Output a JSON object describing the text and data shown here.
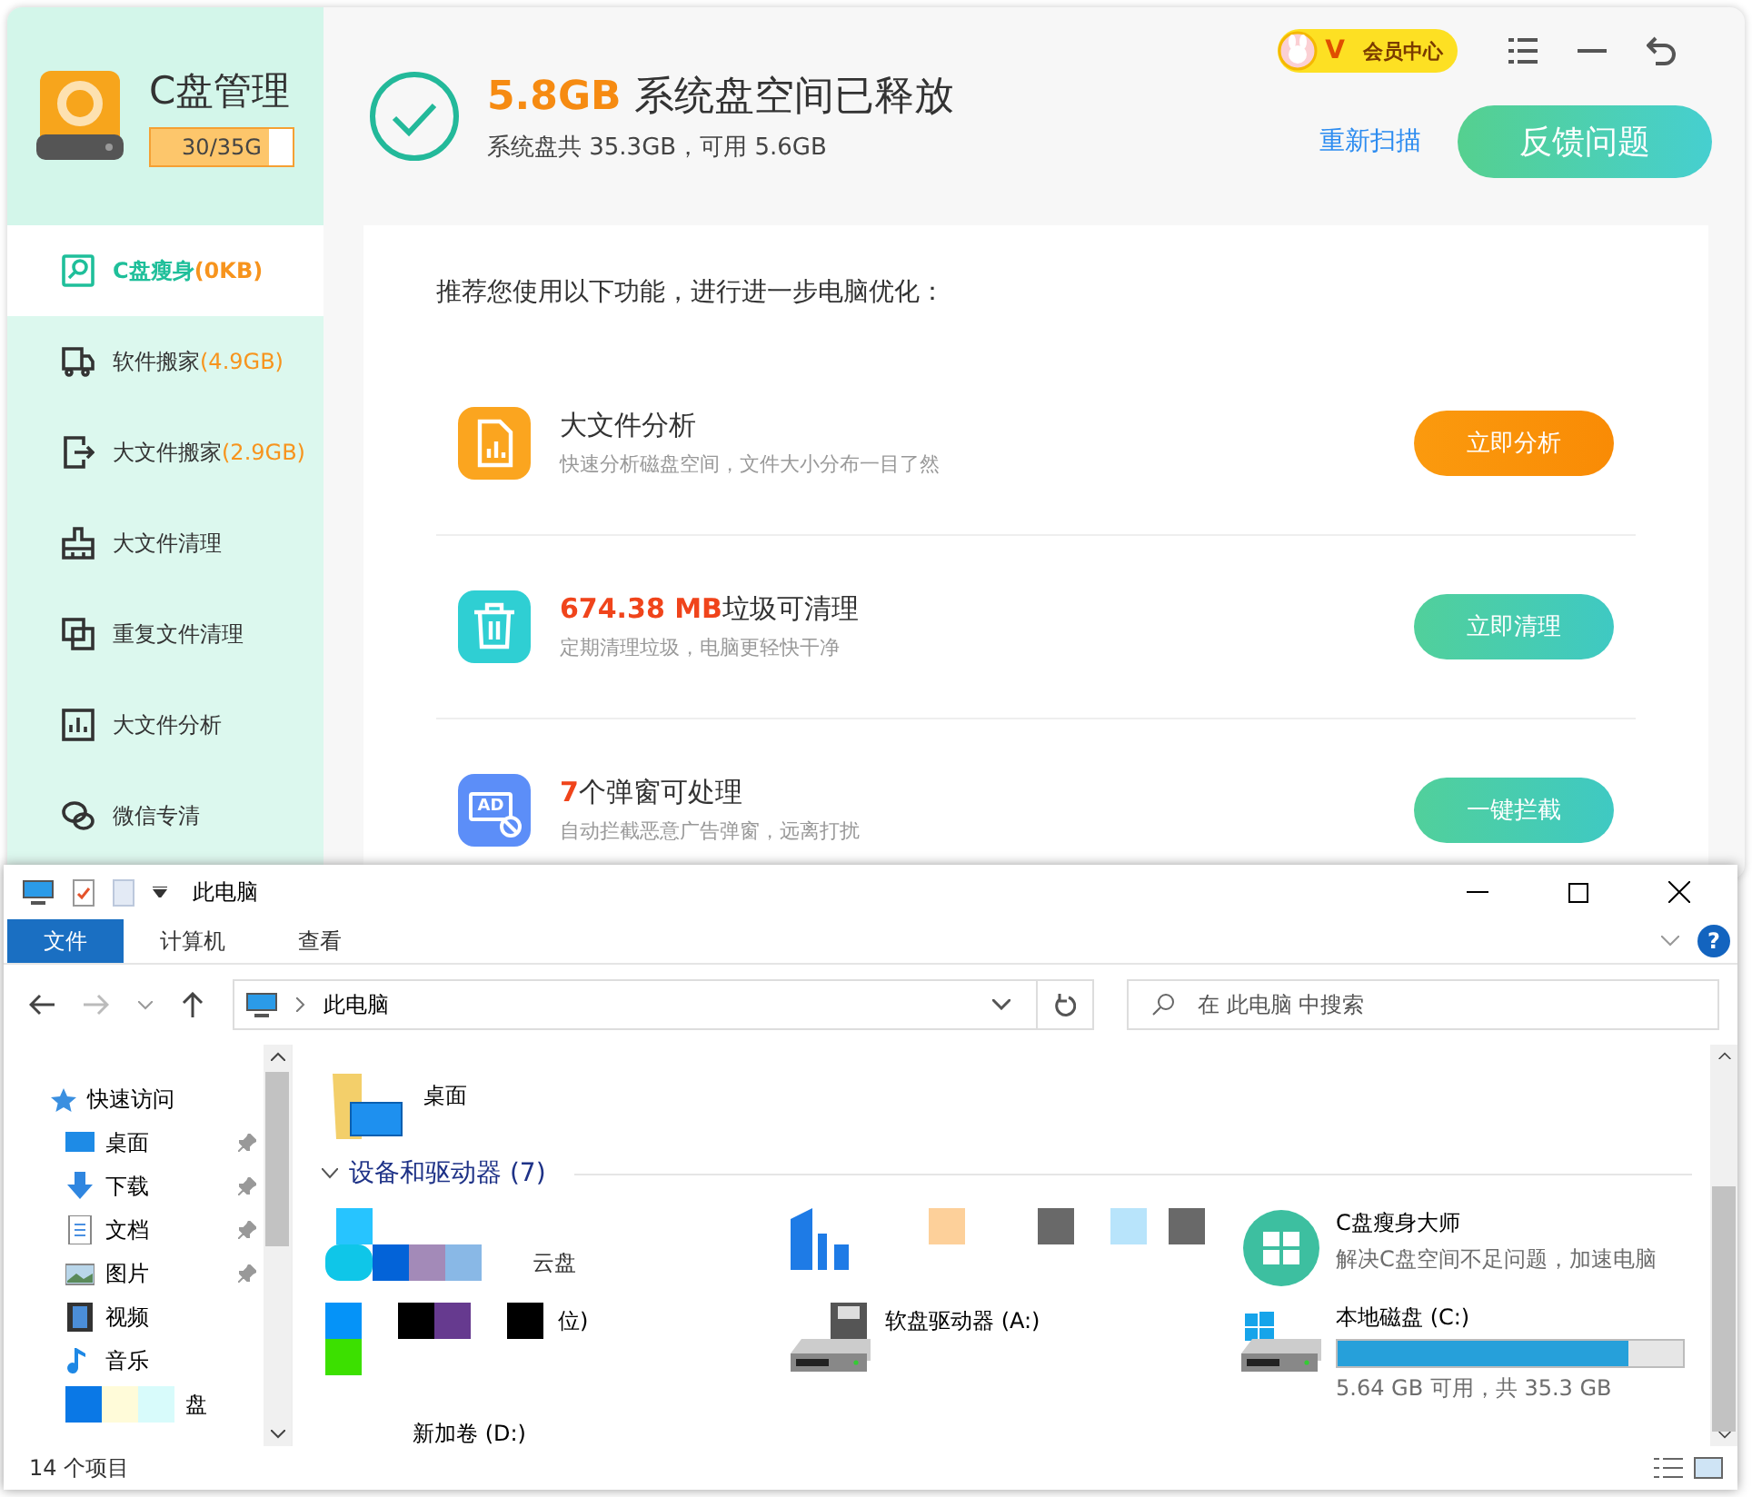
{
  "app": {
    "title": "C盘管理",
    "capacity": {
      "text": "30/35G",
      "level": 0.83
    },
    "vip": {
      "badge": "V",
      "label": "会员中心"
    },
    "header": {
      "highlight": "5.8GB",
      "title": "系统盘空间已释放",
      "subtitle": "系统盘共 35.3GB，可用 5.6GB",
      "rescan": "重新扫描",
      "feedback": "反馈问题"
    },
    "sidebar": [
      {
        "kind": "slim",
        "label": "C盘瘦身",
        "extra": "(0KB)",
        "selected": true
      },
      {
        "kind": "truck",
        "label": "软件搬家",
        "extra": "(4.9GB)",
        "selected": false
      },
      {
        "kind": "move",
        "label": "大文件搬家",
        "extra": "(2.9GB)",
        "selected": false
      },
      {
        "kind": "broom",
        "label": "大文件清理",
        "selected": false
      },
      {
        "kind": "copy",
        "label": "重复文件清理",
        "selected": false
      },
      {
        "kind": "chart",
        "label": "大文件分析",
        "selected": false
      },
      {
        "kind": "wechat",
        "label": "微信专清",
        "selected": false
      }
    ],
    "intro": "推荐您使用以下功能，进行进一步电脑优化：",
    "cards": [
      {
        "kind": "file",
        "title": "大文件分析",
        "desc": "快速分析磁盘空间，文件大小分布一目了然",
        "button": "立即分析"
      },
      {
        "kind": "trash",
        "highlight": "674.38 MB",
        "title": "垃圾可清理",
        "desc": "定期清理垃圾，电脑更轻快干净",
        "button": "立即清理"
      },
      {
        "kind": "ad",
        "icon_text": "AD",
        "highlight": "7",
        "title": "个弹窗可处理",
        "desc": "自动拦截恶意广告弹窗，远离打扰",
        "button": "一键拦截"
      }
    ]
  },
  "explorer": {
    "title": "此电脑",
    "ribbon_tabs": [
      {
        "label": "文件",
        "selected": true
      },
      {
        "label": "计算机",
        "selected": false
      },
      {
        "label": "查看",
        "selected": false
      }
    ],
    "help": "?",
    "address": "此电脑",
    "search": {
      "placeholder": "在 此电脑 中搜索"
    },
    "nav": {
      "quick_access": "快速访问",
      "items": [
        {
          "kind": "desktop",
          "label": "桌面",
          "pinned": true
        },
        {
          "kind": "download",
          "label": "下载",
          "pinned": true
        },
        {
          "kind": "doc",
          "label": "文档",
          "pinned": true
        },
        {
          "kind": "picture",
          "label": "图片",
          "pinned": true
        },
        {
          "kind": "video",
          "label": "视频",
          "pinned": false
        },
        {
          "kind": "music",
          "label": "音乐",
          "pinned": false
        },
        {
          "kind": "redacted",
          "label": "盘",
          "pinned": false
        }
      ]
    },
    "folders": [
      {
        "label": "桌面"
      }
    ],
    "group": "设备和驱动器 (7)",
    "drives": [
      {
        "kind": "redacted",
        "label": "云盘"
      },
      {
        "kind": "app-redacted"
      },
      {
        "kind": "app",
        "label": "C盘瘦身大师",
        "desc": "解决C盘空间不足问题，加速电脑"
      },
      {
        "kind": "redacted2",
        "label": "位)"
      },
      {
        "kind": "floppy",
        "label": "软盘驱动器 (A:)"
      },
      {
        "kind": "disk",
        "label": "本地磁盘 (C:)",
        "level": 0.84,
        "desc": "5.64 GB 可用，共 35.3 GB"
      },
      {
        "kind": "partial",
        "label": "新加卷 (D:)"
      }
    ],
    "status": "14 个项目"
  }
}
